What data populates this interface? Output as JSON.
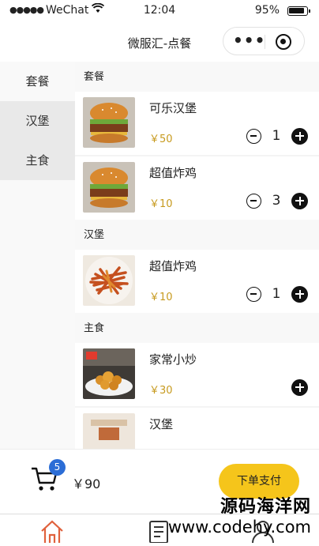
{
  "status_bar": {
    "carrier": "WeChat",
    "time": "12:04",
    "battery": "95%"
  },
  "nav": {
    "title": "微服汇-点餐"
  },
  "sidebar": {
    "items": [
      {
        "label": "套餐"
      },
      {
        "label": "汉堡"
      },
      {
        "label": "主食"
      }
    ]
  },
  "sections": [
    {
      "title": "套餐",
      "items": [
        {
          "name": "可乐汉堡",
          "price": "￥50",
          "qty": "1"
        },
        {
          "name": "超值炸鸡",
          "price": "￥10",
          "qty": "3"
        }
      ]
    },
    {
      "title": "汉堡",
      "items": [
        {
          "name": "超值炸鸡",
          "price": "￥10",
          "qty": "1"
        }
      ]
    },
    {
      "title": "主食",
      "items": [
        {
          "name": "家常小炒",
          "price": "￥30"
        },
        {
          "name": "汉堡"
        }
      ]
    }
  ],
  "cart": {
    "badge": "5",
    "total": "￥90",
    "checkout_label": "下单支付"
  },
  "watermark": {
    "line1": "源码海洋网",
    "line2": "www.codehy.com"
  },
  "colors": {
    "accent": "#f5c51b",
    "price": "#c79a1e",
    "badge": "#2b6dd6"
  }
}
